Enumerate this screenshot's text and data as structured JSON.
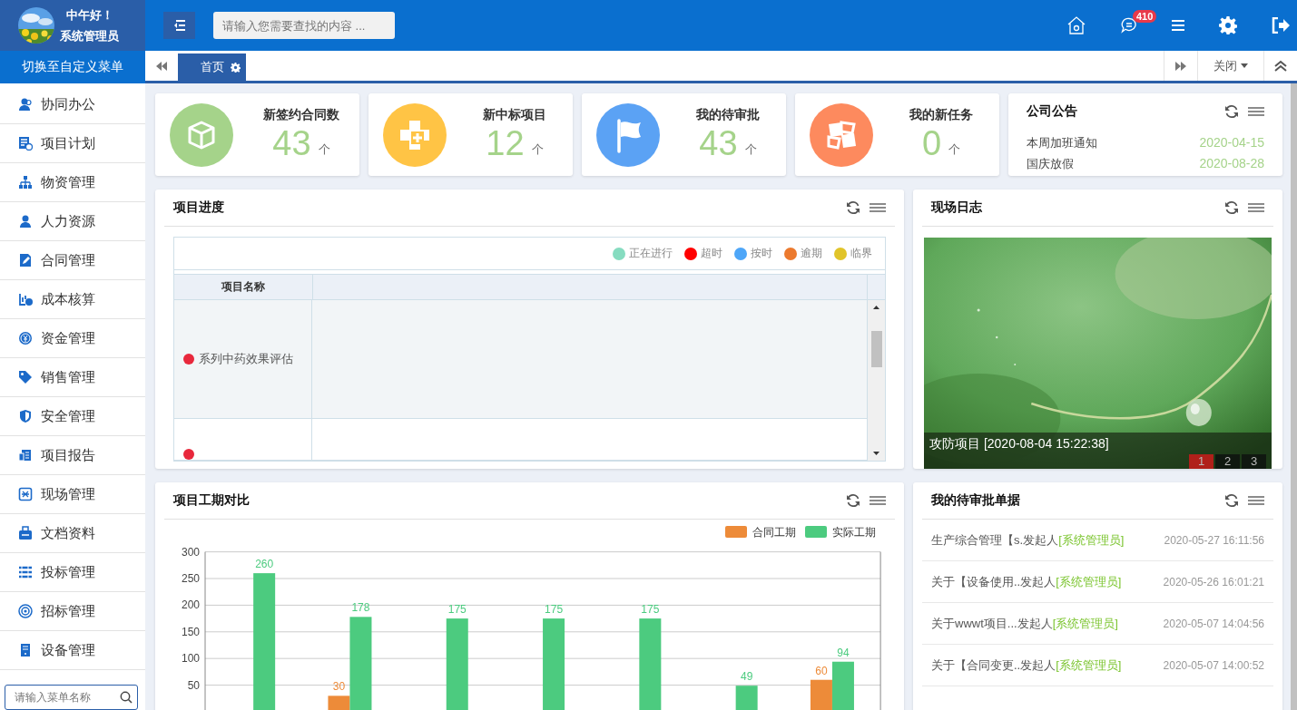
{
  "header": {
    "greeting": "中午好！",
    "user": "系统管理员",
    "search": {
      "placeholder": "请输入您需要查找的内容 ..."
    },
    "message_badge": "410"
  },
  "menu_switch": "切换至自定义菜单",
  "tabs": [
    {
      "label": "首页",
      "selected": true
    }
  ],
  "close_button": "关闭",
  "sidebar": {
    "items": [
      {
        "label": "协同办公"
      },
      {
        "label": "项目计划"
      },
      {
        "label": "物资管理"
      },
      {
        "label": "人力资源"
      },
      {
        "label": "合同管理"
      },
      {
        "label": "成本核算"
      },
      {
        "label": "资金管理"
      },
      {
        "label": "销售管理"
      },
      {
        "label": "安全管理"
      },
      {
        "label": "项目报告"
      },
      {
        "label": "现场管理"
      },
      {
        "label": "文档资料"
      },
      {
        "label": "投标管理"
      },
      {
        "label": "招标管理"
      },
      {
        "label": "设备管理"
      }
    ],
    "search": {
      "placeholder": "请输入菜单名称"
    }
  },
  "stats": [
    {
      "label": "新签约合同数",
      "value": "43",
      "unit": "个",
      "color": "#a5d38a"
    },
    {
      "label": "新中标项目",
      "value": "12",
      "unit": "个",
      "color": "#ffc445"
    },
    {
      "label": "我的待审批",
      "value": "43",
      "unit": "个",
      "color": "#5ba2f4"
    },
    {
      "label": "我的新任务",
      "value": "0",
      "unit": "个",
      "color": "#fd8a5e"
    }
  ],
  "announcements": {
    "title": "公司公告",
    "items": [
      {
        "text": "本周加班通知",
        "date": "2020-04-15"
      },
      {
        "text": "国庆放假",
        "date": "2020-08-28"
      }
    ]
  },
  "progress": {
    "title": "项目进度",
    "legend": [
      {
        "label": "正在进行",
        "color": "#86dcc0"
      },
      {
        "label": "超时",
        "color": "#ff0000"
      },
      {
        "label": "按时",
        "color": "#4ea6f8"
      },
      {
        "label": "逾期",
        "color": "#ec7a2e"
      },
      {
        "label": "临界",
        "color": "#e1c42a"
      }
    ],
    "columns": [
      "项目名称"
    ],
    "rows": [
      {
        "name": "系列中药效果评估",
        "color": "#e8283c",
        "selected": true
      },
      {
        "color": "#e8283c",
        "selected": false
      }
    ]
  },
  "site_log": {
    "title": "现场日志",
    "caption": "攻防项目 [2020-08-04 15:22:38]",
    "pages": [
      {
        "label": "1",
        "selected": true
      },
      {
        "label": "2",
        "selected": false
      },
      {
        "label": "3",
        "selected": false
      }
    ]
  },
  "duration_chart": {
    "title": "项目工期对比",
    "chart_data": {
      "type": "bar",
      "series": [
        {
          "name": "合同工期",
          "color": "#ed8b39",
          "values": [
            null,
            30,
            null,
            null,
            null,
            null,
            60
          ]
        },
        {
          "name": "实际工期",
          "color": "#4ccb7f",
          "values": [
            260,
            178,
            175,
            175,
            175,
            49,
            94
          ]
        }
      ],
      "ylim": [
        0,
        300
      ],
      "yticks": [
        50,
        100,
        150,
        200,
        250,
        300
      ],
      "data_labels": true,
      "grid": true,
      "legend": true
    }
  },
  "approvals": {
    "title": "我的待审批单据",
    "items": [
      {
        "title": "生产综合管理【s.发起人",
        "initiator": "[系统管理员]",
        "time": "2020-05-27 16:11:56"
      },
      {
        "title": "关于【设备使用..发起人",
        "initiator": "[系统管理员]",
        "time": "2020-05-26 16:01:21"
      },
      {
        "title": "关于wwwt项目...发起人",
        "initiator": "[系统管理员]",
        "time": "2020-05-07 14:04:56"
      },
      {
        "title": "关于【合同变更..发起人",
        "initiator": "[系统管理员]",
        "time": "2020-05-07 14:00:52"
      }
    ]
  }
}
